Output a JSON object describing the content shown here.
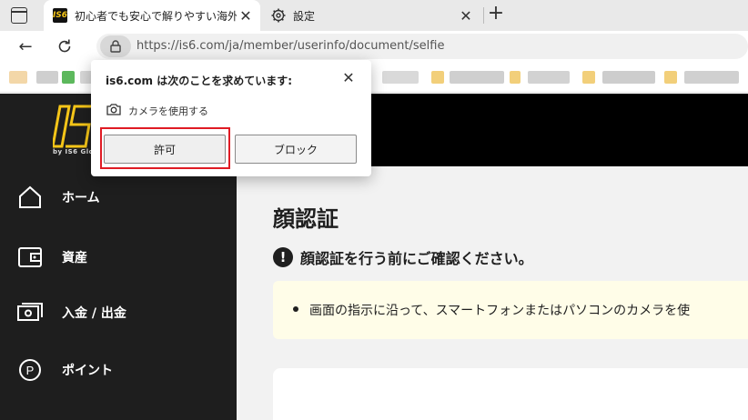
{
  "browser": {
    "tabs": [
      {
        "title": "初心者でも安心で解りやすい海外FX",
        "favicon_text": "IS6",
        "active": true
      },
      {
        "title": "設定",
        "active": false
      }
    ],
    "url": "https://is6.com/ja/member/userinfo/document/selfie"
  },
  "permission_dialog": {
    "title": "is6.com は次のことを求めています:",
    "permission_label": "カメラを使用する",
    "allow_label": "許可",
    "block_label": "ブロック",
    "highlight_color": "#e01b24"
  },
  "site": {
    "brand_subtitle": "by IS6 Glo",
    "nav": [
      {
        "label": "ホーム",
        "icon": "home-icon"
      },
      {
        "label": "資産",
        "icon": "wallet-icon"
      },
      {
        "label": "入金 / 出金",
        "icon": "cash-icon"
      },
      {
        "label": "ポイント",
        "icon": "points-icon"
      }
    ],
    "page_title": "顔認証",
    "notice": "顔認証を行う前にご確認ください。",
    "info_line": "画面の指示に沿って、スマートフォンまたはパソコンのカメラを使"
  },
  "colors": {
    "brand_yellow": "#f5c518",
    "sidebar_bg": "#1e1e1e",
    "notice_bg": "#fffde8"
  }
}
